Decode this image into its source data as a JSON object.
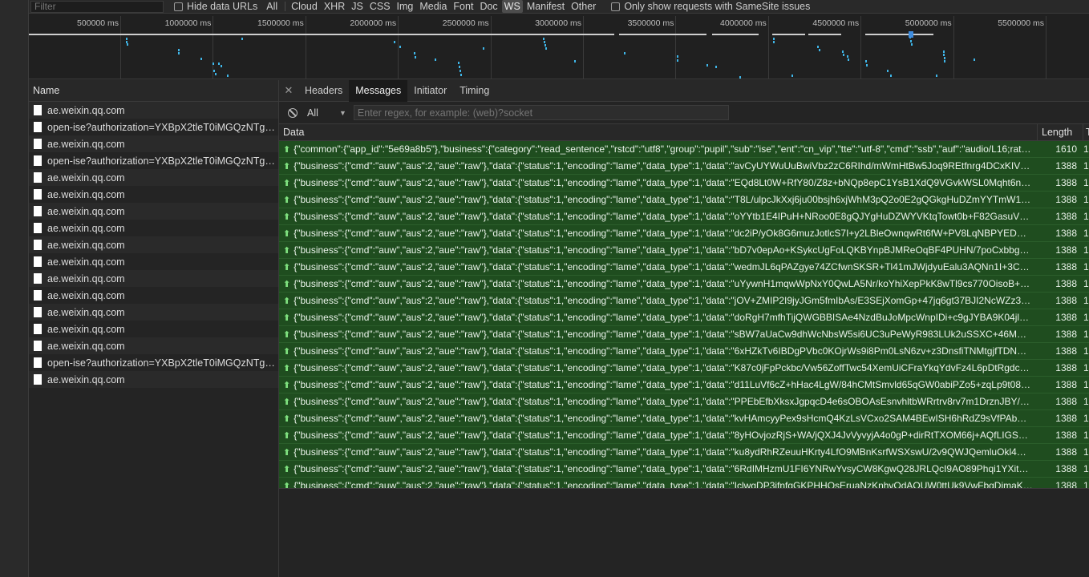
{
  "filter": {
    "placeholder": "Filter"
  },
  "hide_data_urls_label": "Hide data URLs",
  "type_filters": [
    {
      "label": "All",
      "active": false
    },
    {
      "label": "Cloud",
      "active": false
    },
    {
      "label": "XHR",
      "active": false
    },
    {
      "label": "JS",
      "active": false
    },
    {
      "label": "CSS",
      "active": false
    },
    {
      "label": "Img",
      "active": false
    },
    {
      "label": "Media",
      "active": false
    },
    {
      "label": "Font",
      "active": false
    },
    {
      "label": "Doc",
      "active": false
    },
    {
      "label": "WS",
      "active": true
    },
    {
      "label": "Manifest",
      "active": false
    },
    {
      "label": "Other",
      "active": false
    }
  ],
  "samesite_label": "Only show requests with SameSite issues",
  "overview": {
    "ticks": [
      "500000 ms",
      "1000000 ms",
      "1500000 ms",
      "2000000 ms",
      "2500000 ms",
      "3000000 ms",
      "3500000 ms",
      "4000000 ms",
      "4500000 ms",
      "5000000 ms",
      "5500000 ms"
    ]
  },
  "name_panel": {
    "header": "Name",
    "rows": [
      "ae.weixin.qq.com",
      "open-ise?authorization=YXBpX2tleT0iMGQzNTg5O...",
      "ae.weixin.qq.com",
      "open-ise?authorization=YXBpX2tleT0iMGQzNTg5O...",
      "ae.weixin.qq.com",
      "ae.weixin.qq.com",
      "ae.weixin.qq.com",
      "ae.weixin.qq.com",
      "ae.weixin.qq.com",
      "ae.weixin.qq.com",
      "ae.weixin.qq.com",
      "ae.weixin.qq.com",
      "ae.weixin.qq.com",
      "ae.weixin.qq.com",
      "ae.weixin.qq.com",
      "open-ise?authorization=YXBpX2tleT0iMGQzNTg5O...",
      "ae.weixin.qq.com"
    ]
  },
  "detail": {
    "tabs": [
      {
        "label": "Headers",
        "active": false
      },
      {
        "label": "Messages",
        "active": true
      },
      {
        "label": "Initiator",
        "active": false
      },
      {
        "label": "Timing",
        "active": false
      }
    ],
    "message_filter": {
      "select_value": "All",
      "placeholder": "Enter regex, for example: (web)?socket"
    },
    "columns": {
      "data": "Data",
      "length": "Length",
      "time": "T"
    },
    "messages": [
      {
        "data": "{\"common\":{\"app_id\":\"5e69a8b5\"},\"business\":{\"category\":\"read_sentence\",\"rstcd\":\"utf8\",\"group\":\"pupil\",\"sub\":\"ise\",\"ent\":\"cn_vip\",\"tte\":\"utf-8\",\"cmd\":\"ssb\",\"auf\":\"audio/L16;rate...",
        "length": "1610",
        "time": "1"
      },
      {
        "data": "{\"business\":{\"cmd\":\"auw\",\"aus\":2,\"aue\":\"raw\"},\"data\":{\"status\":1,\"encoding\":\"lame\",\"data_type\":1,\"data\":\"avCyUYWuUuBwiVbz2zC6RIhd/mWmHtBw5Joq9REtfnrg4DCxKIVCa6AZ...",
        "length": "1388",
        "time": "1"
      },
      {
        "data": "{\"business\":{\"cmd\":\"auw\",\"aus\":2,\"aue\":\"raw\"},\"data\":{\"status\":1,\"encoding\":\"lame\",\"data_type\":1,\"data\":\"EQd8Lt0W+RfY80/Z8z+bNQp8epC1YsB1XdQ9VGvkWSL0Mqht6ne3j9M...",
        "length": "1388",
        "time": "1"
      },
      {
        "data": "{\"business\":{\"cmd\":\"auw\",\"aus\":2,\"aue\":\"raw\"},\"data\":{\"status\":1,\"encoding\":\"lame\",\"data_type\":1,\"data\":\"T8L/ulpcJkXxj6ju00bsjh6xjWhM3pQ2o0E2gQGkgHuDZmYYTmW1JbdpY...",
        "length": "1388",
        "time": "1"
      },
      {
        "data": "{\"business\":{\"cmd\":\"auw\",\"aus\":2,\"aue\":\"raw\"},\"data\":{\"status\":1,\"encoding\":\"lame\",\"data_type\":1,\"data\":\"oYYtb1E4IPuH+NRoo0E8gQJYgHuDZWYVKtqTowt0b+F82GasuVzQzfDX...",
        "length": "1388",
        "time": "1"
      },
      {
        "data": "{\"business\":{\"cmd\":\"auw\",\"aus\":2,\"aue\":\"raw\"},\"data\":{\"status\":1,\"encoding\":\"lame\",\"data_type\":1,\"data\":\"dc2iP/yOk8G6muzJotlcS7I+y2LBleOwnqwRt6fW+PV8LqNBPYEDDIB7g2...",
        "length": "1388",
        "time": "1"
      },
      {
        "data": "{\"business\":{\"cmd\":\"auw\",\"aus\":2,\"aue\":\"raw\"},\"data\":{\"status\":1,\"encoding\":\"lame\",\"data_type\":1,\"data\":\"bD7v0epAo+KSykcUgFoLQKBYnpBJMReOqBF4PUHN/7poCxbbgANbS6...",
        "length": "1388",
        "time": "1"
      },
      {
        "data": "{\"business\":{\"cmd\":\"auw\",\"aus\":2,\"aue\":\"raw\"},\"data\":{\"status\":1,\"encoding\":\"lame\",\"data_type\":1,\"data\":\"wedmJL6qPAZgye74ZCfwnSKSR+Tl41mJWjdyuEalu3AQNn1I+3C7lhQo...",
        "length": "1388",
        "time": "1"
      },
      {
        "data": "{\"business\":{\"cmd\":\"auw\",\"aus\":2,\"aue\":\"raw\"},\"data\":{\"status\":1,\"encoding\":\"lame\",\"data_type\":1,\"data\":\"uYywnH1mqwWpNxY0QwLA5Nr/koYhiXepPkK8wTl9cs770OisoB+5RXG...",
        "length": "1388",
        "time": "1"
      },
      {
        "data": "{\"business\":{\"cmd\":\"auw\",\"aus\":2,\"aue\":\"raw\"},\"data\":{\"status\":1,\"encoding\":\"lame\",\"data_type\":1,\"data\":\"jOV+ZMIP2I9jyJGm5fmIbAs/E3SEjXomGp+47jq6gt37BJI2NcWZz3sHJA4...",
        "length": "1388",
        "time": "1"
      },
      {
        "data": "{\"business\":{\"cmd\":\"auw\",\"aus\":2,\"aue\":\"raw\"},\"data\":{\"status\":1,\"encoding\":\"lame\",\"data_type\":1,\"data\":\"doRgH7mfhTijQWGBBISAe4NzdBuJoMpcWnpIDi+c9gJYBA9K04jlWJrh/...",
        "length": "1388",
        "time": "1"
      },
      {
        "data": "{\"business\":{\"cmd\":\"auw\",\"aus\":2,\"aue\":\"raw\"},\"data\":{\"status\":1,\"encoding\":\"lame\",\"data_type\":1,\"data\":\"sBW7aUaCw9dhWcNbsW5si6UC3uPeWyR983LUk2uSSXC+46MmsQJai...",
        "length": "1388",
        "time": "1"
      },
      {
        "data": "{\"business\":{\"cmd\":\"auw\",\"aus\":2,\"aue\":\"raw\"},\"data\":{\"status\":1,\"encoding\":\"lame\",\"data_type\":1,\"data\":\"6xHZkTv6IBDgPVbc0KOjrWs9i8Pm0LsN6zv+z3DnsfiTNMtgjfTDNU4BZH...",
        "length": "1388",
        "time": "1"
      },
      {
        "data": "{\"business\":{\"cmd\":\"auw\",\"aus\":2,\"aue\":\"raw\"},\"data\":{\"status\":1,\"encoding\":\"lame\",\"data_type\":1,\"data\":\"K87c0jFpPckbc/Vw56ZoffTwc54XemUiCFraYkqYdvFz4L6pDtRgdcv4LiQo...",
        "length": "1388",
        "time": "1"
      },
      {
        "data": "{\"business\":{\"cmd\":\"auw\",\"aus\":2,\"aue\":\"raw\"},\"data\":{\"status\":1,\"encoding\":\"lame\",\"data_type\":1,\"data\":\"d11LuVf6cZ+hHac4LgW/84hCMtSmvld65qGW0abiPZo5+zqLp9t08JGL7...",
        "length": "1388",
        "time": "1"
      },
      {
        "data": "{\"business\":{\"cmd\":\"auw\",\"aus\":2,\"aue\":\"raw\"},\"data\":{\"status\":1,\"encoding\":\"lame\",\"data_type\":1,\"data\":\"PPEbEfbXksxJgpqcD4e6sOBOAsEsnvhltbWRrtrv8rv7m1DrznJBY/xzivd3...",
        "length": "1388",
        "time": "1"
      },
      {
        "data": "{\"business\":{\"cmd\":\"auw\",\"aus\":2,\"aue\":\"raw\"},\"data\":{\"status\":1,\"encoding\":\"lame\",\"data_type\":1,\"data\":\"kvHAmcyyPex9sHcmQ4KzLsVCxo2SAM4BEwISH6hRdZ9sVfPAbRGXkHa...",
        "length": "1388",
        "time": "1"
      },
      {
        "data": "{\"business\":{\"cmd\":\"auw\",\"aus\":2,\"aue\":\"raw\"},\"data\":{\"status\":1,\"encoding\":\"lame\",\"data_type\":1,\"data\":\"8yHOvjozRjS+WA/jQXJ4JvVyvyjA4o0gP+dirRtTXOM66j+AQfLIGSaXVA...",
        "length": "1388",
        "time": "1"
      },
      {
        "data": "{\"business\":{\"cmd\":\"auw\",\"aus\":2,\"aue\":\"raw\"},\"data\":{\"status\":1,\"encoding\":\"lame\",\"data_type\":1,\"data\":\"ku8ydRhRZeuuHKrty4LfO9MBnKsrfWSXswU/2v9QWJQemluOkl4m+2sT...",
        "length": "1388",
        "time": "1"
      },
      {
        "data": "{\"business\":{\"cmd\":\"auw\",\"aus\":2,\"aue\":\"raw\"},\"data\":{\"status\":1,\"encoding\":\"lame\",\"data_type\":1,\"data\":\"6RdIMHzmU1FI6YNRwYvsyCW8KgwQ28JRLQcI9AO89Phqi1YXitB2gcLcY...",
        "length": "1388",
        "time": "1"
      },
      {
        "data": "{\"business\":{\"cmd\":\"auw\",\"aus\":2,\"aue\":\"raw\"},\"data\":{\"status\":1,\"encoding\":\"lame\",\"data_type\":1,\"data\":\"IclwgDP3ifnfqGKPHHQsEruaNzKnhvOdAOUW0ttUk9VwFbqDjmaKQy2C...",
        "length": "1388",
        "time": "1"
      }
    ]
  },
  "colors": {
    "message_row_bg": "#1f4d1f",
    "timeline_dot": "#3fb6e8",
    "active_tab_bg": "#1a1a1a"
  }
}
